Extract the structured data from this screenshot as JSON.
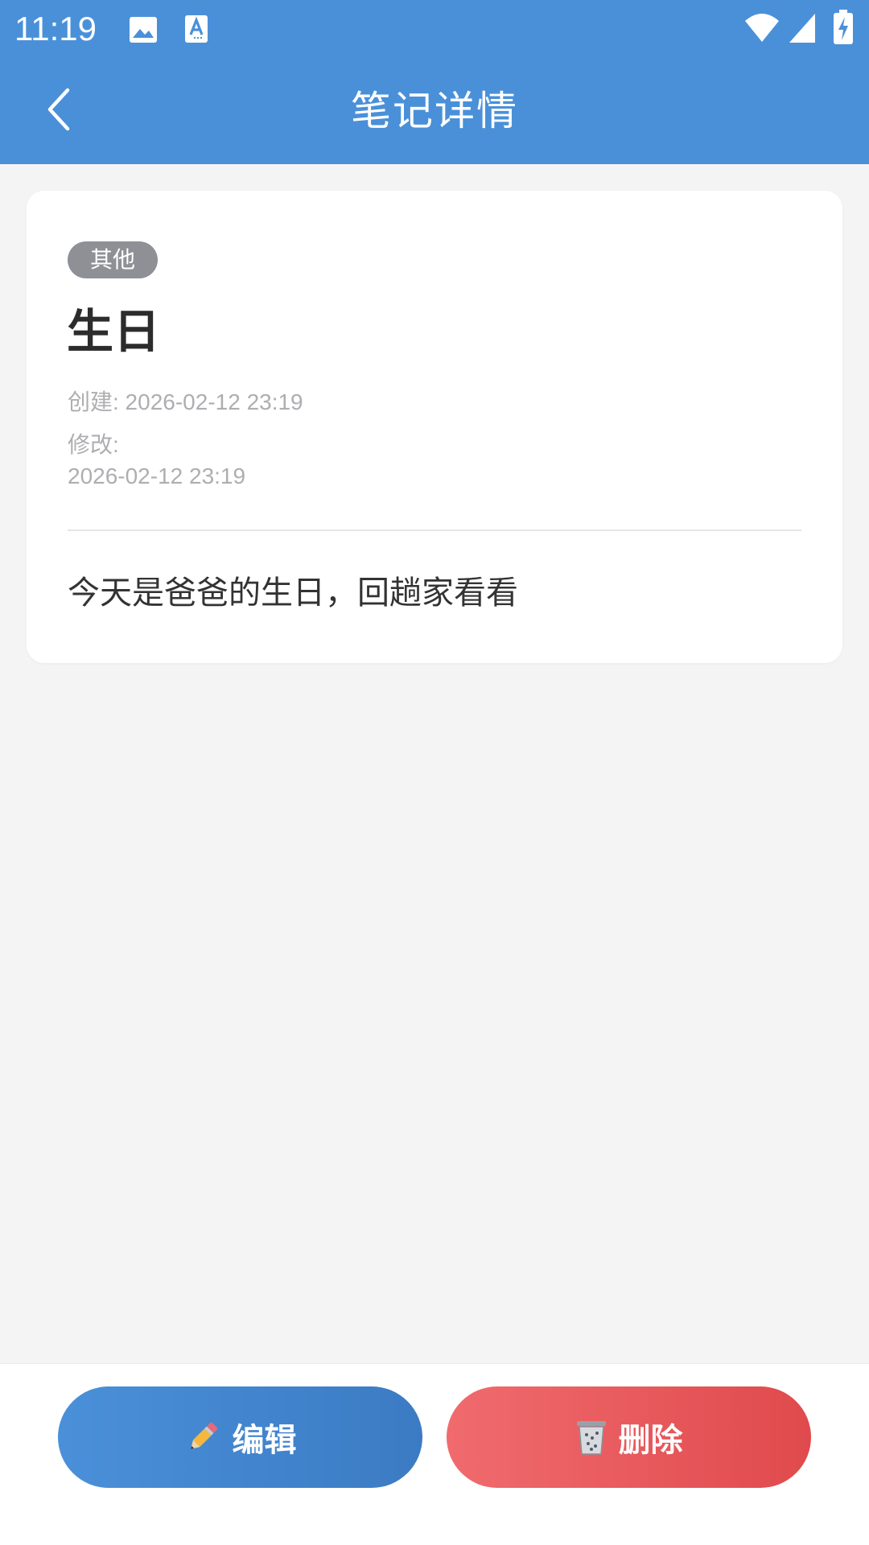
{
  "status_bar": {
    "time": "11:19",
    "icons": [
      "image-icon",
      "text-a-icon",
      "wifi-icon",
      "signal-icon",
      "battery-charging-icon"
    ]
  },
  "app_bar": {
    "title": "笔记详情",
    "back_icon": "chevron-left-icon"
  },
  "note": {
    "category": "其他",
    "title": "生日",
    "created_text": "创建: 2026-02-12 23:19",
    "modified_label": "修改:",
    "modified_value": "2026-02-12 23:19",
    "body": "今天是爸爸的生日，回趟家看看"
  },
  "actions": {
    "edit_label": "编辑",
    "edit_icon": "pencil-icon",
    "delete_label": "删除",
    "delete_icon": "trash-icon"
  },
  "colors": {
    "primary": "#4a90d9",
    "danger": "#e85558",
    "badge": "#8e9096",
    "background": "#f4f4f5"
  }
}
